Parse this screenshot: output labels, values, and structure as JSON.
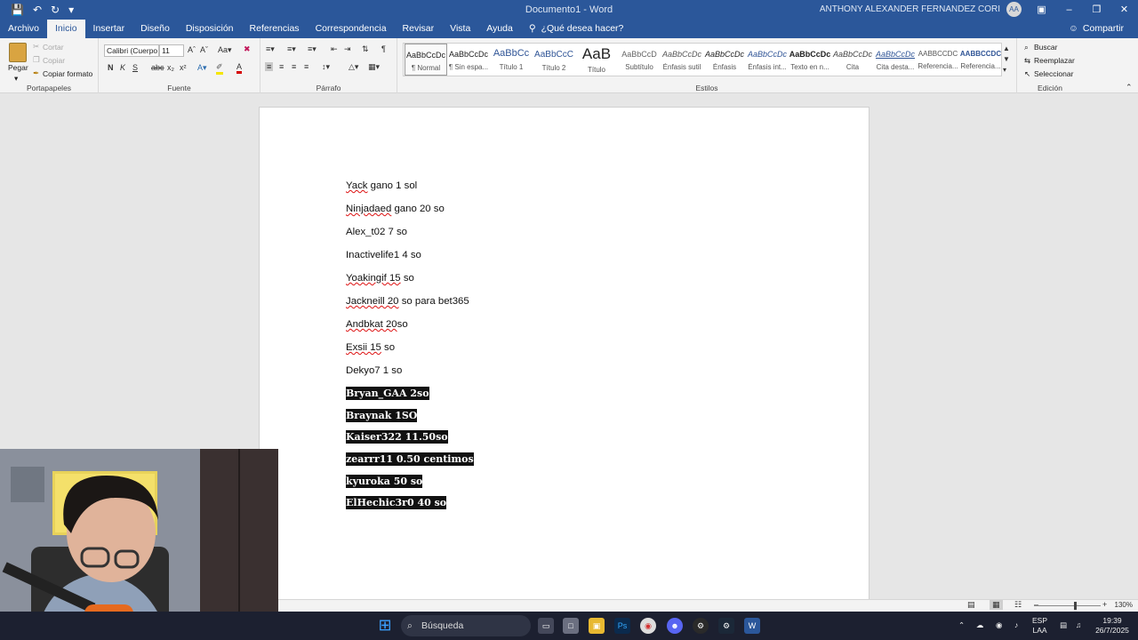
{
  "window": {
    "title": "Documento1 - Word",
    "user_name": "ANTHONY ALEXANDER FERNANDEZ CORI",
    "user_initials": "AA"
  },
  "ribbon_tabs": [
    "Archivo",
    "Inicio",
    "Insertar",
    "Diseño",
    "Disposición",
    "Referencias",
    "Correspondencia",
    "Revisar",
    "Vista",
    "Ayuda"
  ],
  "tell_me": "¿Qué desea hacer?",
  "share": "Compartir",
  "clipboard": {
    "paste": "Pegar",
    "cut": "Cortar",
    "copy": "Copiar",
    "format_painter": "Copiar formato",
    "label": "Portapapeles"
  },
  "font": {
    "name": "Calibri (Cuerpo",
    "size": "11",
    "label": "Fuente"
  },
  "paragraph": {
    "label": "Párrafo"
  },
  "styles": {
    "label": "Estilos",
    "items": [
      {
        "preview": "AaBbCcDc",
        "name": "¶ Normal"
      },
      {
        "preview": "AaBbCcDc",
        "name": "¶ Sin espa..."
      },
      {
        "preview": "AaBbCc",
        "name": "Título 1"
      },
      {
        "preview": "AaBbCcC",
        "name": "Título 2"
      },
      {
        "preview": "AaB",
        "name": "Título"
      },
      {
        "preview": "AaBbCcD",
        "name": "Subtítulo"
      },
      {
        "preview": "AaBbCcDc",
        "name": "Énfasis sutil"
      },
      {
        "preview": "AaBbCcDc",
        "name": "Énfasis"
      },
      {
        "preview": "AaBbCcDc",
        "name": "Énfasis int..."
      },
      {
        "preview": "AaBbCcDc",
        "name": "Texto en n..."
      },
      {
        "preview": "AaBbCcDc",
        "name": "Cita"
      },
      {
        "preview": "AaBbCcDc",
        "name": "Cita desta..."
      },
      {
        "preview": "AABBCCDC",
        "name": "Referencia..."
      },
      {
        "preview": "AABBCCDC",
        "name": "Referencia..."
      }
    ]
  },
  "editing": {
    "find": "Buscar",
    "replace": "Reemplazar",
    "select": "Seleccionar",
    "label": "Edición"
  },
  "document": {
    "lines": [
      {
        "pre": "Yack",
        "post": " gano 1 sol"
      },
      {
        "pre": "Ninjadaed",
        "post": " gano 20 so"
      },
      {
        "pre": "",
        "post": "Alex_t02 7 so"
      },
      {
        "pre": "",
        "post": "Inactivelife1 4 so"
      },
      {
        "pre": "Yoakingif  15",
        "post": " so"
      },
      {
        "pre": "Jackneill  20",
        "post": " so para bet365"
      },
      {
        "pre": "Andbkat  20",
        "post": "so"
      },
      {
        "pre": "Exsii  15",
        "post": " so"
      },
      {
        "pre": "",
        "post": "Dekyo7 1 so"
      }
    ],
    "highlighted": [
      "Bryan_GAA 2so",
      "Braynak 1SO",
      "Kaiser322 11.50so",
      "zearrr11 0.50 centimos",
      "kyuroka 50 so",
      "ElHechic3r0 40 so"
    ]
  },
  "statusbar": {
    "zoom": "130%"
  },
  "taskbar": {
    "search": "Búsqueda",
    "lang": "ESP",
    "layout": "LAA",
    "time": "19:39",
    "date": "26/7/2025"
  }
}
